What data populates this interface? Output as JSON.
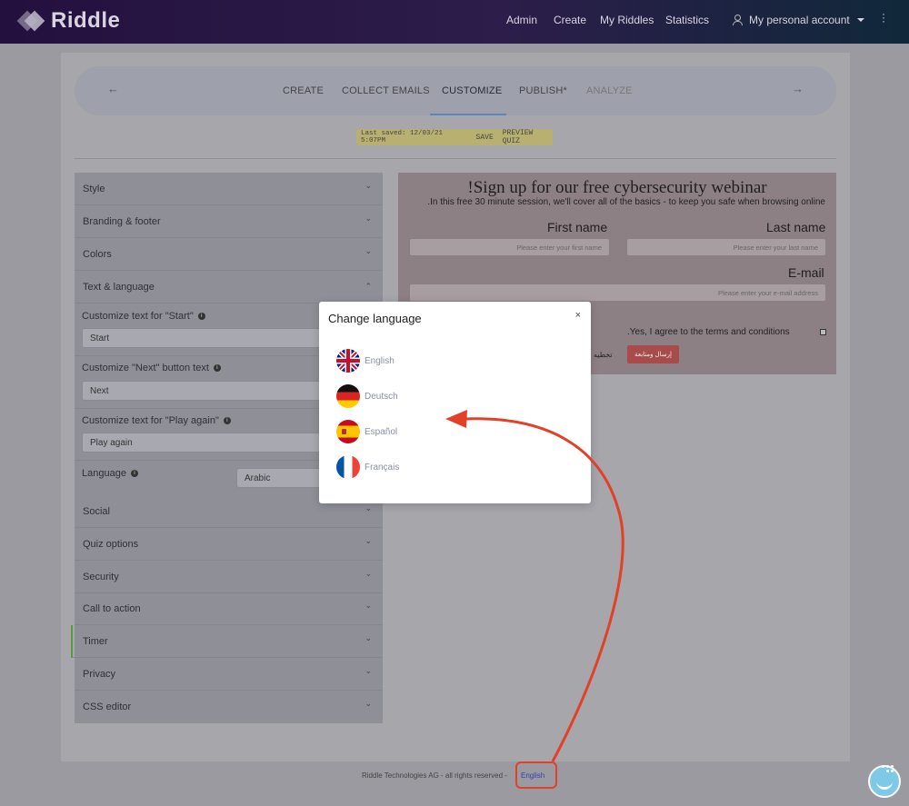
{
  "brand": {
    "name": "Riddle"
  },
  "nav": {
    "items": [
      "Admin",
      "Create",
      "My Riddles",
      "Statistics"
    ],
    "account": "My personal account"
  },
  "steps": {
    "items": [
      "CREATE",
      "COLLECT EMAILS",
      "CUSTOMIZE",
      "PUBLISH*",
      "ANALYZE"
    ],
    "active": "CUSTOMIZE"
  },
  "savebar": {
    "last_saved": "Last saved: 12/03/21 5:07PM",
    "save": "SAVE",
    "preview": "PREVIEW QUIZ"
  },
  "settings": {
    "sections": [
      "Style",
      "Branding & footer",
      "Colors",
      "Text & language",
      "Social",
      "Quiz options",
      "Security",
      "Call to action",
      "Timer",
      "Privacy",
      "CSS editor"
    ],
    "start_label": "Customize text for \"Start\"",
    "start_value": "Start",
    "next_label": "Customize \"Next\" button text",
    "next_value": "Next",
    "play_again_label": "Customize text for \"Play again\"",
    "play_again_value": "Play again",
    "language_label": "Language",
    "language_value": "Arabic"
  },
  "preview": {
    "title": "!Sign up for our free cybersecurity webinar",
    "subtitle": ".In this free 30 minute session, we'll cover all of the basics - to keep you safe when browsing online",
    "first_name_label": "First name",
    "first_name_placeholder": "Please enter your first name",
    "last_name_label": "Last name",
    "last_name_placeholder": "Please enter your last name",
    "email_label": "E-mail",
    "email_placeholder": "Please enter your e-mail address",
    "terms": ".Yes, I agree to the terms and conditions",
    "submit": "إرسال ومتابعة",
    "skip": "تخطيه"
  },
  "modal": {
    "title": "Change language",
    "close": "×",
    "languages": [
      "English",
      "Deutsch",
      "Español",
      "Français"
    ],
    "flags": [
      "uk-flag-icon",
      "germany-flag-icon",
      "spain-flag-icon",
      "france-flag-icon"
    ]
  },
  "footer": {
    "copyright": "Riddle Technologies AG - all rights reserved -",
    "language_link": "English"
  },
  "colors": {
    "annotation": "#e24027",
    "active_tab": "#5b86c4",
    "timer_accent": "#5b9b3a"
  }
}
